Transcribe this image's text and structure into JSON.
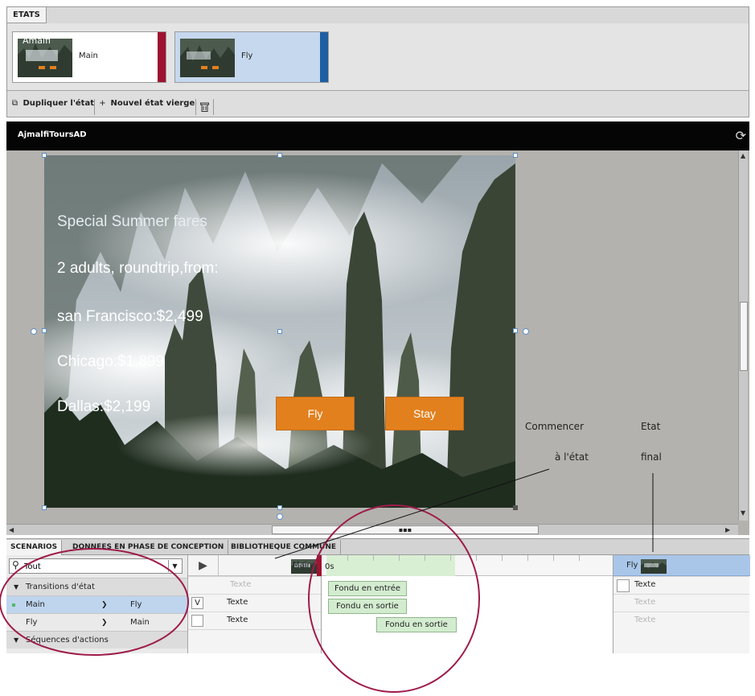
{
  "states_panel": {
    "tab_label": "ETATS",
    "states": [
      {
        "name": "Main",
        "thumbnail_title": "Amalfi"
      },
      {
        "name": "Fly",
        "thumbnail_title": ""
      }
    ],
    "toolbar": {
      "duplicate_label": "Dupliquer l'état",
      "new_state_label": "Nouvel état vierge"
    }
  },
  "stage": {
    "title": "AjmalfiToursAD",
    "promo_lines": [
      "Special Summer fares",
      "2 adults, roundtrip,from:",
      "san Francisco:$2,499",
      "Chicago:$1,899",
      "Dallas:$2,199"
    ],
    "buttons": {
      "fly": "Fly",
      "stay": "Stay"
    }
  },
  "callouts": {
    "start_state": [
      "Commencer",
      "à l'état"
    ],
    "end_state": [
      "Etat",
      "final"
    ]
  },
  "bottom_tabs": [
    "SCENARIOS",
    "DONNEES EN PHASE DE CONCEPTION",
    "BIBLIOTHEQUE COMMUNE"
  ],
  "scenarios": {
    "search": {
      "value": "Tout",
      "placeholder": ""
    },
    "transitions_header": "Transitions d'état",
    "transitions": [
      {
        "from": "Main",
        "to": "Fly",
        "selected": true
      },
      {
        "from": "Fly",
        "to": "Main",
        "selected": false
      }
    ],
    "sequences_header": "Séquences d'actions"
  },
  "timeline": {
    "start_state": "Main",
    "end_state": "Fly",
    "ruler_zero": "0s",
    "properties": [
      {
        "checkbox": "",
        "label": "Texte",
        "dim": true
      },
      {
        "checkbox": "V",
        "label": "Texte",
        "dim": false
      },
      {
        "checkbox": "",
        "label": "Texte",
        "dim": false
      }
    ],
    "effects": [
      "Fondu en entrée",
      "Fondu en sortie",
      "Fondu en sortie"
    ],
    "end_properties": [
      {
        "label": "Texte",
        "dim": false
      },
      {
        "label": "Texte",
        "dim": true
      },
      {
        "label": "Texte",
        "dim": true
      }
    ]
  },
  "colors": {
    "main_state_accent": "#9e1330",
    "fly_state_accent": "#1d5fa2",
    "cta_orange": "#e2801e",
    "annotation_circle": "#9e1b4a",
    "effect_bar": "#d3ecd0"
  },
  "icons": {
    "duplicate": "duplicate-icon",
    "new_state": "plus-icon",
    "delete": "trash-icon",
    "refresh": "refresh-icon",
    "search": "search-icon",
    "play": "play-icon"
  }
}
